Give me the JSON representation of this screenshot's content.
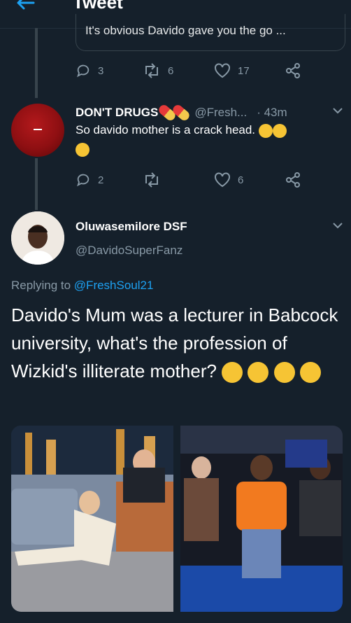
{
  "header": {
    "title": "Tweet",
    "back_icon": "arrow-left-icon",
    "accent": "#1da1f2"
  },
  "quoted_card": {
    "text": "It's obvious Davido gave you the go ..."
  },
  "first_actions": {
    "reply": "3",
    "retweet": "6",
    "like": "17"
  },
  "reply_tweet": {
    "name": "DON'T DRUGS",
    "handle": "@Fresh...",
    "time": "· 43m",
    "text": "So davido mother is a crack head.",
    "actions": {
      "reply": "2",
      "retweet": "",
      "like": "6"
    }
  },
  "main_tweet": {
    "name": "Oluwasemilore DSF",
    "handle": "@DavidoSuperFanz",
    "replying_prefix": "Replying to",
    "replying_to": "@FreshSoul21",
    "text": "Davido's Mum was a lecturer in Babcock university, what's the profession of Wizkid's illiterate mother?"
  },
  "colors": {
    "background": "#15202b",
    "muted": "#8899a6",
    "link": "#1da1f2",
    "divider": "#38444d"
  }
}
